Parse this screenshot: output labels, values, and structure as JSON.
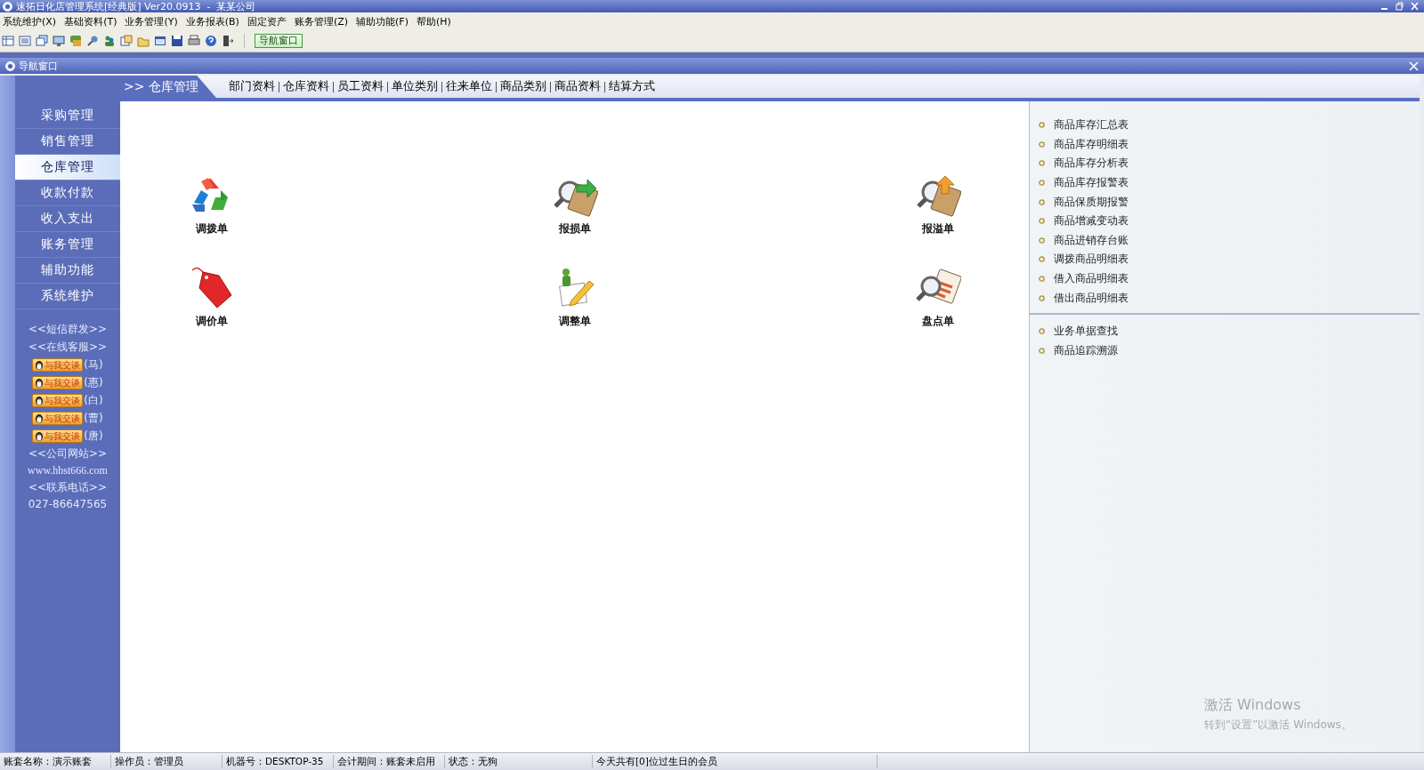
{
  "window": {
    "title": "速拓日化店管理系统[经典版] Ver20.0913  -  某某公司"
  },
  "menu": [
    "系统维护(X)",
    "基础资料(T)",
    "业务管理(Y)",
    "业务报表(B)",
    "固定资产",
    "账务管理(Z)",
    "辅助功能(F)",
    "帮助(H)"
  ],
  "toolbar": {
    "nav_button": "导航窗口"
  },
  "nav_window": {
    "title": "导航窗口"
  },
  "sidebar": {
    "items": [
      {
        "label": "采购管理",
        "selected": false
      },
      {
        "label": "销售管理",
        "selected": false
      },
      {
        "label": "仓库管理",
        "selected": true
      },
      {
        "label": "收款付款",
        "selected": false
      },
      {
        "label": "收入支出",
        "selected": false
      },
      {
        "label": "账务管理",
        "selected": false
      },
      {
        "label": "辅助功能",
        "selected": false
      },
      {
        "label": "系统维护",
        "selected": false
      }
    ],
    "links": [
      "<<短信群发>>",
      "<<在线客服>>"
    ],
    "chat": [
      {
        "badge": "与我交谈",
        "name": "(马)"
      },
      {
        "badge": "与我交谈",
        "name": "(惠)"
      },
      {
        "badge": "与我交谈",
        "name": "(白)"
      },
      {
        "badge": "与我交谈",
        "name": "(曹)"
      },
      {
        "badge": "与我交谈",
        "name": "(唐)"
      }
    ],
    "website_label": "<<公司网站>>",
    "website": "www.hbst666.com",
    "phone_label": "<<联系电话>>",
    "phone": "027-86647565"
  },
  "section": {
    "title": ">> 仓库管理",
    "links": [
      "部门资料",
      "仓库资料",
      "员工资料",
      "单位类别",
      "往来单位",
      "商品类别",
      "商品资料",
      "结算方式"
    ]
  },
  "documents": [
    {
      "label": "调拨单",
      "kind": "recycle"
    },
    {
      "label": "报损单",
      "kind": "loss"
    },
    {
      "label": "报溢单",
      "kind": "overflow"
    },
    {
      "label": "调价单",
      "kind": "tag"
    },
    {
      "label": "调整单",
      "kind": "edit"
    },
    {
      "label": "盘点单",
      "kind": "count"
    }
  ],
  "reports": {
    "groups": [
      [
        "商品库存汇总表",
        "商品库存明细表",
        "商品库存分析表",
        "商品库存报警表",
        "商品保质期报警",
        "商品增减变动表",
        "商品进销存台账",
        "调拨商品明细表",
        "借入商品明细表",
        "借出商品明细表"
      ],
      [
        "业务单据查找",
        "商品追踪溯源"
      ]
    ]
  },
  "activation": {
    "title": "激活 Windows",
    "hint": "转到“设置”以激活 Windows。"
  },
  "status_bar": [
    "账套名称：演示账套",
    "操作员：管理员",
    "机器号：DESKTOP-35",
    "会计期间：账套未启用",
    "状态：无狗",
    "今天共有[0]位过生日的会员"
  ]
}
